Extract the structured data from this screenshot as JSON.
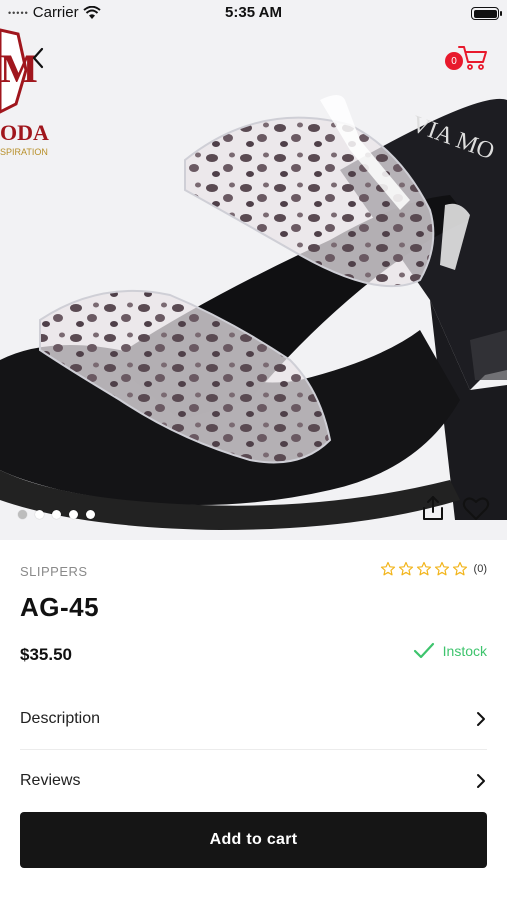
{
  "status_bar": {
    "carrier": "Carrier",
    "time": "5:35 AM"
  },
  "hero": {
    "logo_text": "ODA",
    "logo_tagline": "SPIRATION",
    "brand_print": "VIA MO",
    "cart_count": "0",
    "image_dots": 5,
    "active_dot": 1
  },
  "product": {
    "category": "SLIPPERS",
    "rating_count": "(0)",
    "name": "AG-45",
    "price": "$35.50",
    "stock": "Instock"
  },
  "rows": {
    "description": "Description",
    "reviews": "Reviews"
  },
  "actions": {
    "add_to_cart": "Add to cart"
  },
  "colors": {
    "accent_red": "#e8192c",
    "stock_green": "#3ec46d",
    "cta_black": "#151515",
    "star_gold": "#f2b51c"
  }
}
